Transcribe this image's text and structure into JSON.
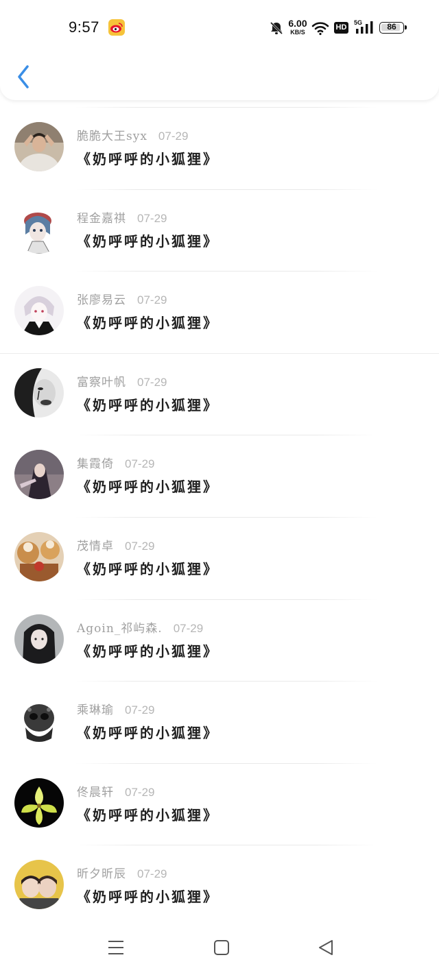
{
  "status_bar": {
    "time": "9:57",
    "net_speed_value": "6.00",
    "net_speed_unit": "KB/S",
    "hd_label": "HD",
    "network_label": "5G",
    "battery": "86"
  },
  "comments": [
    {
      "name": "脆脆大王syx",
      "date": "07-29",
      "message": "《奶呼呼的小狐狸》"
    },
    {
      "name": "程金嘉祺",
      "date": "07-29",
      "message": "《奶呼呼的小狐狸》"
    },
    {
      "name": "张廖易云",
      "date": "07-29",
      "message": "《奶呼呼的小狐狸》"
    },
    {
      "name": "富察叶帆",
      "date": "07-29",
      "message": "《奶呼呼的小狐狸》"
    },
    {
      "name": "集霞倚",
      "date": "07-29",
      "message": "《奶呼呼的小狐狸》"
    },
    {
      "name": "茂情卓",
      "date": "07-29",
      "message": "《奶呼呼的小狐狸》"
    },
    {
      "name": "Agoin_祁屿森.",
      "date": "07-29",
      "message": "《奶呼呼的小狐狸》"
    },
    {
      "name": "乘琳瑜",
      "date": "07-29",
      "message": "《奶呼呼的小狐狸》"
    },
    {
      "name": "佟晨轩",
      "date": "07-29",
      "message": "《奶呼呼的小狐狸》"
    },
    {
      "name": "昕夕昕辰",
      "date": "07-29",
      "message": "《奶呼呼的小狐狸》"
    }
  ],
  "colors": {
    "back_arrow": "#3a8ee6",
    "name_text": "#a0a0a0",
    "message_text": "#202020"
  },
  "icons": {
    "back": "chevron-left-icon",
    "nav_menu": "menu-icon",
    "nav_home": "home-square-icon",
    "nav_back": "back-triangle-icon"
  }
}
